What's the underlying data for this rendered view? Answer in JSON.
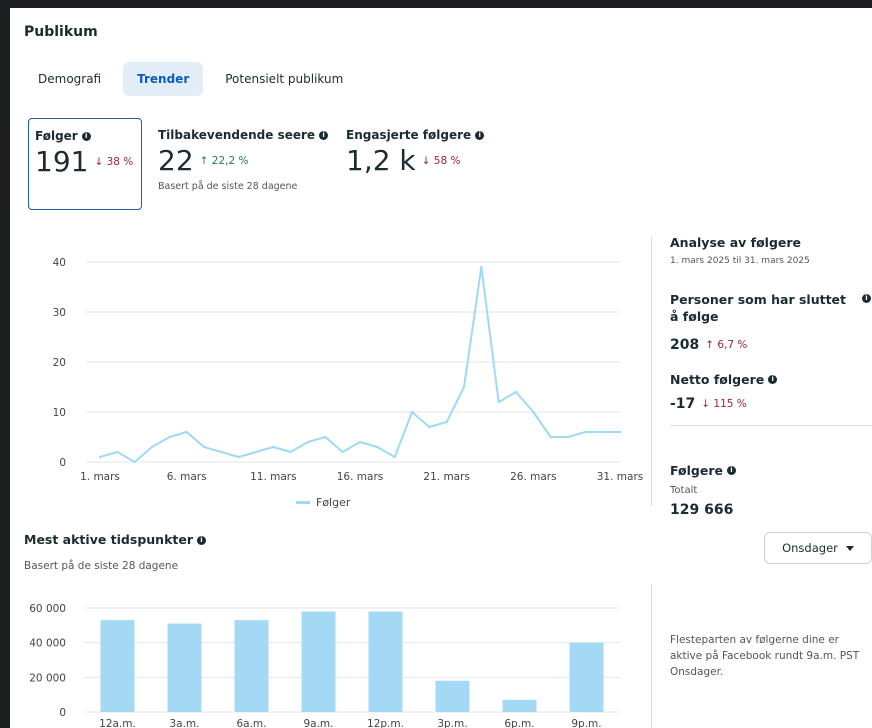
{
  "section_title": "Publikum",
  "tabs": [
    {
      "label": "Demografi",
      "active": false
    },
    {
      "label": "Trender",
      "active": true
    },
    {
      "label": "Potensielt publikum",
      "active": false
    }
  ],
  "metrics": [
    {
      "label": "Følger",
      "value": "191",
      "change": "↓ 38 %",
      "direction": "down",
      "selected": true
    },
    {
      "label": "Tilbakevendende seere",
      "value": "22",
      "change": "↑ 22,2 %",
      "direction": "up",
      "selected": false
    },
    {
      "label": "Engasjerte følgere",
      "value": "1,2 k",
      "change": "↓ 58 %",
      "direction": "down",
      "selected": false
    }
  ],
  "metrics_note": "Basert på de siste 28 dagene",
  "legend_label": "Følger",
  "colors": {
    "accent": "#0a5bbf",
    "series": "#9fd9f8",
    "bar": "#a3d9f5",
    "down": "#a0243b",
    "up": "#237d52"
  },
  "right": {
    "analysis_title": "Analyse av følgere",
    "analysis_range": "1. mars 2025 til 31. mars 2025",
    "unfollow_label": "Personer som har sluttet å følge",
    "unfollow_value": "208",
    "unfollow_change": "↑ 6,7 %",
    "net_label": "Netto følgere",
    "net_value": "-17",
    "net_change": "↓ 115 %",
    "followers_label": "Følgere",
    "followers_sub": "Totalt",
    "followers_value": "129 666",
    "active_note": "Flesteparten av følgerne dine er aktive på Facebook rundt 9a.m. PST Onsdager."
  },
  "active_section": {
    "title": "Mest aktive tidspunkter",
    "note": "Basert på de siste 28 dagene",
    "dropdown_value": "Onsdager"
  },
  "chart_data": [
    {
      "type": "line",
      "x": [
        1,
        2,
        3,
        4,
        5,
        6,
        7,
        8,
        9,
        10,
        11,
        12,
        13,
        14,
        15,
        16,
        17,
        18,
        19,
        20,
        21,
        22,
        23,
        24,
        25,
        26,
        27,
        28,
        29,
        30,
        31
      ],
      "x_tick_values": [
        1,
        6,
        11,
        16,
        21,
        26,
        31
      ],
      "x_tick_labels": [
        "1. mars",
        "6. mars",
        "11. mars",
        "16. mars",
        "21. mars",
        "26. mars",
        "31. mars"
      ],
      "y_ticks": [
        0,
        10,
        20,
        30,
        40
      ],
      "ylim": [
        0,
        40
      ],
      "series": [
        {
          "name": "Følger",
          "values": [
            1,
            2,
            0,
            3,
            5,
            6,
            3,
            2,
            1,
            2,
            3,
            2,
            4,
            5,
            2,
            4,
            3,
            1,
            10,
            7,
            8,
            15,
            39,
            12,
            14,
            10,
            5,
            5,
            6,
            6,
            6
          ]
        }
      ],
      "grid": true,
      "legend": "bottom"
    },
    {
      "type": "bar",
      "categories": [
        "12a.m.",
        "3a.m.",
        "6a.m.",
        "9a.m.",
        "12p.m.",
        "3p.m.",
        "6p.m.",
        "9p.m."
      ],
      "values": [
        53000,
        51000,
        53000,
        58000,
        58000,
        18000,
        7000,
        40000
      ],
      "y_ticks": [
        0,
        20000,
        40000,
        60000
      ],
      "y_tick_labels": [
        "0",
        "20 000",
        "40 000",
        "60 000"
      ],
      "ylim": [
        0,
        60000
      ],
      "grid": true
    }
  ]
}
